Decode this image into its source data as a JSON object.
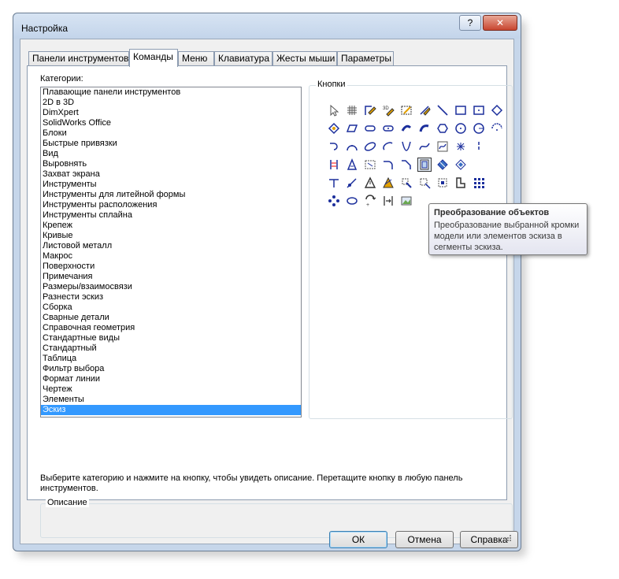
{
  "window": {
    "title": "Настройка"
  },
  "titlebar": {
    "help_glyph": "?",
    "close_glyph": "✕"
  },
  "tabs": [
    "Панели инструментов",
    "Команды",
    "Меню",
    "Клавиатура",
    "Жесты мыши",
    "Параметры"
  ],
  "categories": {
    "label": "Категории:",
    "items": [
      "Плавающие панели инструментов",
      "2D в 3D",
      "DimXpert",
      "SolidWorks Office",
      "Блоки",
      "Быстрые привязки",
      "Вид",
      "Выровнять",
      "Захват экрана",
      "Инструменты",
      "Инструменты для литейной формы",
      "Инструменты расположения",
      "Инструменты сплайна",
      "Крепеж",
      "Кривые",
      "Листовой металл",
      "Макрос",
      "Поверхности",
      "Примечания",
      "Размеры/взаимосвязи",
      "Разнести эскиз",
      "Сборка",
      "Сварные детали",
      "Справочная геометрия",
      "Стандартные виды",
      "Стандартный",
      "Таблица",
      "Фильтр выбора",
      "Формат линии",
      "Чертеж",
      "Элементы",
      "Эскиз"
    ],
    "selected": "Эскиз"
  },
  "buttons_group": {
    "title": "Кнопки",
    "icons": [
      "select-arrow-icon",
      "grid-icon",
      "sketch-pencil-icon",
      "3d-sketch-icon",
      "sketch-picture-icon",
      "smart-dimension-icon",
      "line-icon",
      "rectangle-icon",
      "center-rectangle-icon",
      "parallelogram-diamond-icon",
      "polygon-icon",
      "parallelogram-icon",
      "slot-icon",
      "center-slot-icon",
      "arc-slot-icon",
      "arc-slot-2-icon",
      "polygon-hex-icon",
      "circle-icon",
      "perimeter-circle-icon",
      "centerpoint-arc-icon",
      "tangent-arc-icon",
      "three-point-arc-icon",
      "ellipse-icon",
      "partial-ellipse-icon",
      "parabola-icon",
      "spline-icon",
      "equation-spline-icon",
      "point-icon",
      "centerline-icon",
      "mirror-entities-icon",
      "text-icon",
      "offset-plane-icon",
      "fillet-icon",
      "chamfer-icon",
      "convert-entities-icon",
      "intersection-curve-icon",
      "offset-entities-icon",
      "trim-icon",
      "extend-icon",
      "split-entities-icon",
      "construction-geometry-icon",
      "move-entities-icon",
      "rotate-entities-icon",
      "scale-entities-icon",
      "copy-entities-icon",
      "linear-pattern-icon",
      "circular-pattern-icon",
      "sketch-loop-icon",
      "modify-sketch-icon",
      "stretch-entities-icon",
      "picture-icon"
    ],
    "selected_icon": "convert-entities-icon"
  },
  "tooltip": {
    "title": "Преобразование объектов",
    "body": "Преобразование выбранной кромки модели или элементов эскиза в сегменты эскиза."
  },
  "hint": "Выберите категорию и нажмите на кнопку, чтобы увидеть описание. Перетащите кнопку в любую панель инструментов.",
  "description": {
    "title": "Описание",
    "value": ""
  },
  "footer": {
    "ok": "ОК",
    "cancel": "Отмена",
    "help": "Справка"
  },
  "colors": {
    "selection": "#3399ff",
    "accent": "#e2a000",
    "icon_blue": "#1c2f9c"
  }
}
